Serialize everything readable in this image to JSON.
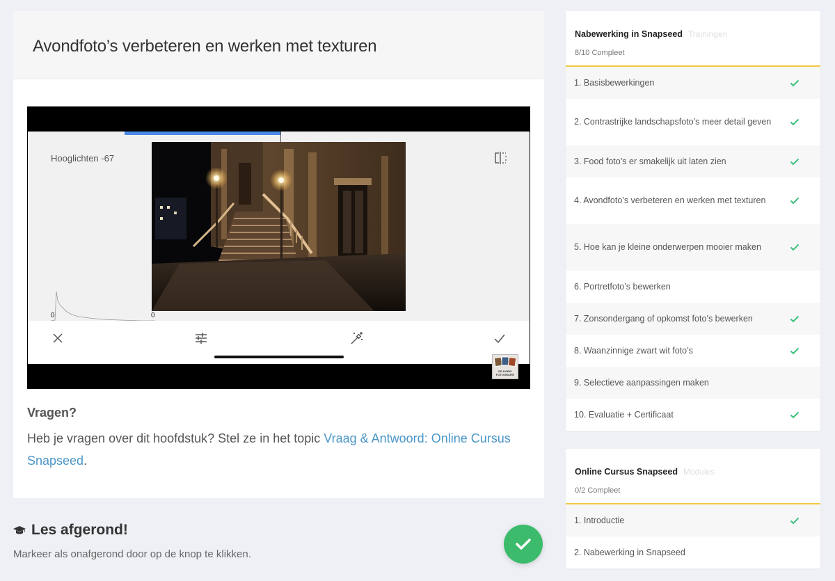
{
  "lesson": {
    "title": "Avondfoto’s verbeteren en werken met texturen"
  },
  "video": {
    "param_label": "Hooglichten -67",
    "hist_min_label": "0",
    "hist_max_label": "0",
    "progress": 0.31,
    "watermark_text": "DE KOEK! FOTOGRAFIE"
  },
  "questions": {
    "title": "Vragen?",
    "text_before": "Heb je vragen over dit hoofdstuk? Stel ze in het topic ",
    "link_text": "Vraag & Antwoord: Online Cursus Snapseed",
    "text_after": "."
  },
  "completion": {
    "title": "Les afgerond!",
    "description": "Markeer als onafgerond door op de knop te klikken."
  },
  "colors": {
    "accent_green": "#3dbb6c",
    "check_green": "#39c07a",
    "link_blue": "#4a96c8",
    "progress_yellow": "#f3c93e"
  },
  "sidebar": {
    "training": {
      "title": "Nabewerking in Snapseed",
      "type": "Trainingen",
      "progress": "8/10 Compleet",
      "chapters": [
        {
          "label": "1. Basisbewerkingen",
          "done": true
        },
        {
          "label": "2. Contrastrijke landschapsfoto’s meer detail geven",
          "done": true
        },
        {
          "label": "3. Food foto’s er smakelijk uit laten zien",
          "done": true
        },
        {
          "label": "4. Avondfoto’s verbeteren en werken met texturen",
          "done": true
        },
        {
          "label": "5. Hoe kan je kleine onderwerpen mooier maken",
          "done": true
        },
        {
          "label": "6. Portretfoto’s bewerken",
          "done": false
        },
        {
          "label": "7. Zonsondergang of opkomst foto’s bewerken",
          "done": true
        },
        {
          "label": "8. Waanzinnige zwart wit foto’s",
          "done": true
        },
        {
          "label": "9. Selectieve aanpassingen maken",
          "done": false
        },
        {
          "label": "10. Evaluatie + Certificaat",
          "done": true
        }
      ]
    },
    "course": {
      "title": "Online Cursus Snapseed",
      "type": "Modules",
      "progress": "0/2 Compleet",
      "chapters": [
        {
          "label": "1. Introductie",
          "done": true
        },
        {
          "label": "2. Nabewerking in Snapseed",
          "done": false
        }
      ]
    }
  }
}
